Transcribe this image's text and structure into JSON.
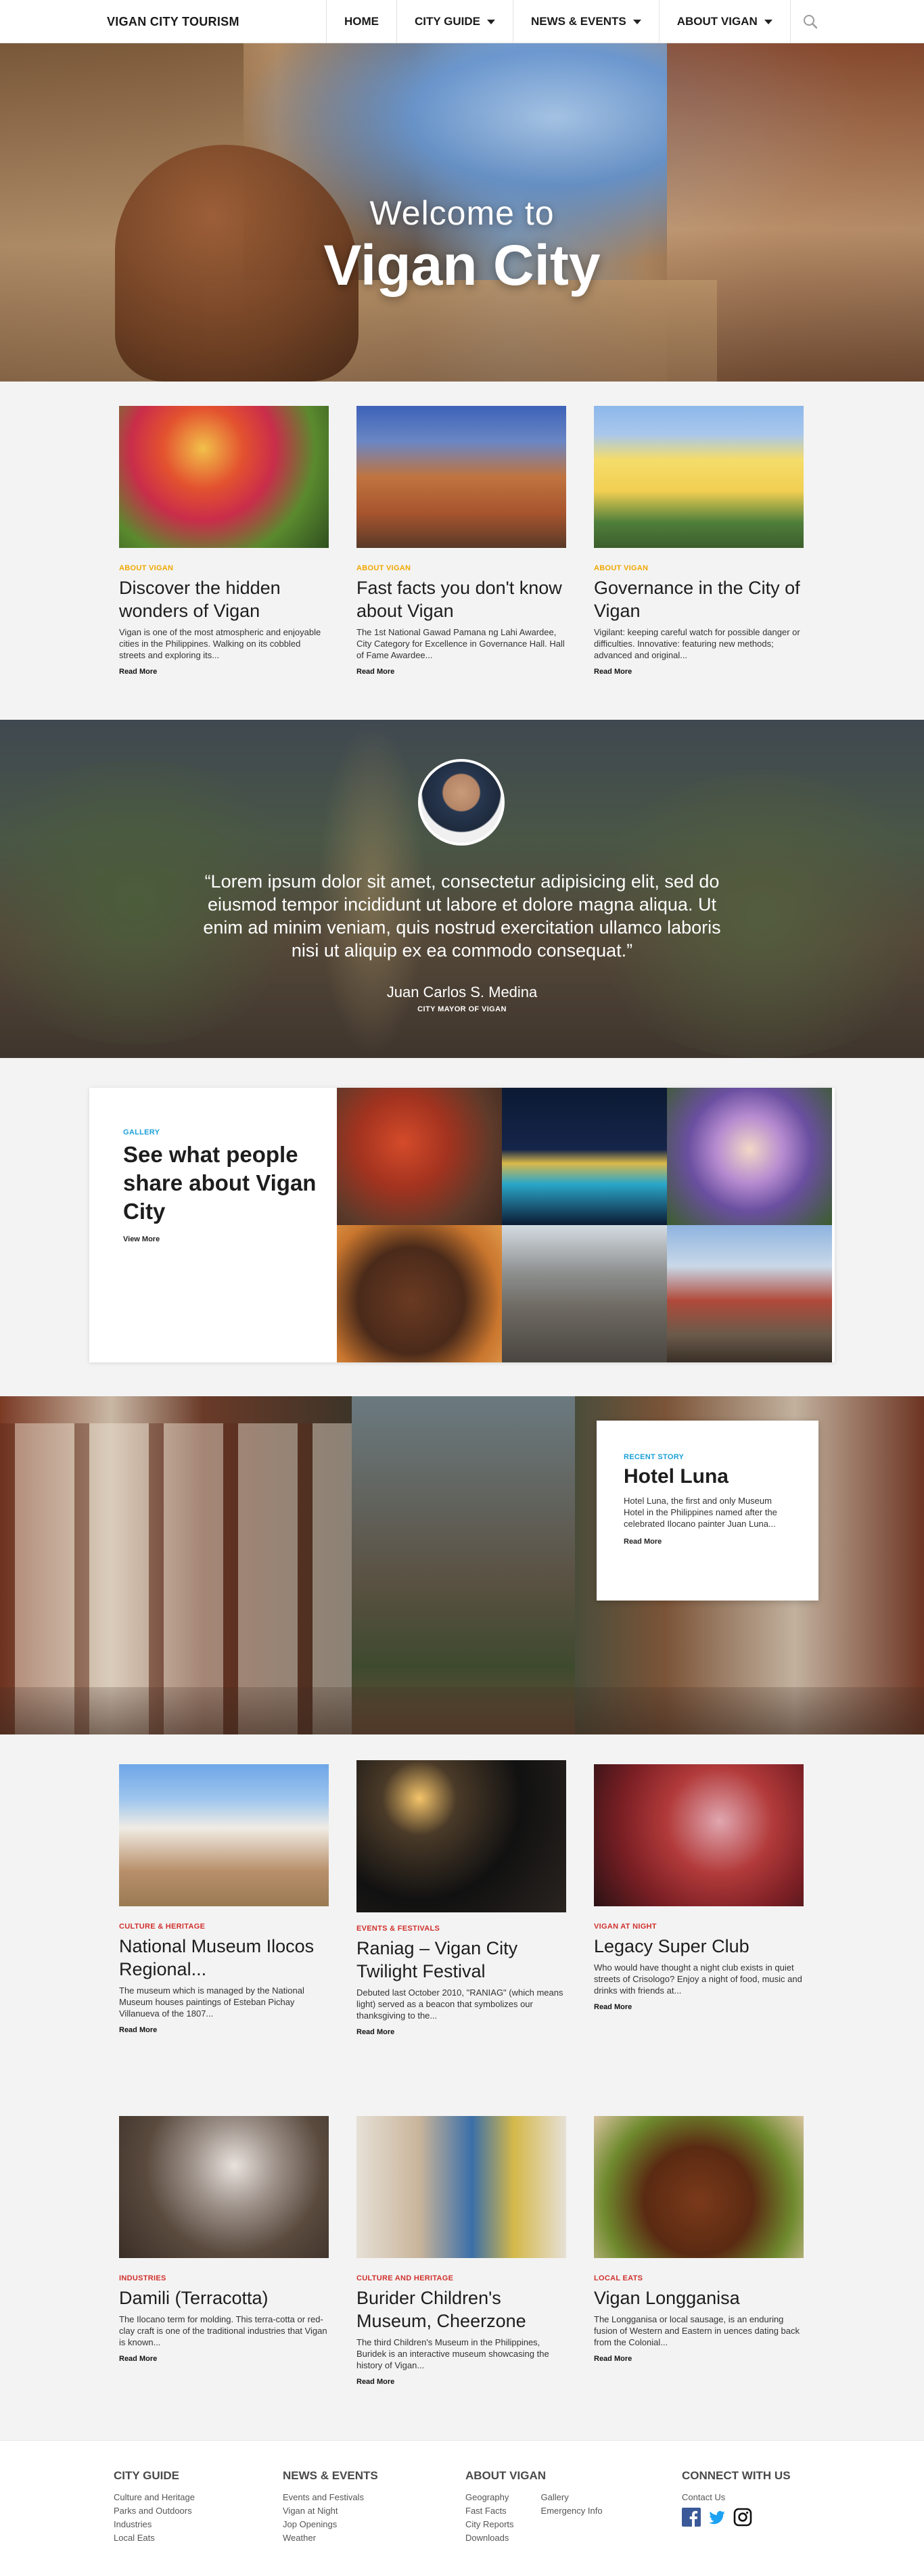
{
  "nav": {
    "brand": "VIGAN CITY TOURISM",
    "items": [
      {
        "label": "HOME"
      },
      {
        "label": "CITY GUIDE"
      },
      {
        "label": "NEWS & EVENTS"
      },
      {
        "label": "ABOUT VIGAN"
      }
    ],
    "search_icon": "search-icon"
  },
  "hero": {
    "welcome": "Welcome to",
    "title": "Vigan City"
  },
  "intro_cards": [
    {
      "category": "ABOUT VIGAN",
      "title": "Discover the hidden wonders of Vigan",
      "excerpt": "Vigan is one of the most atmospheric and enjoyable cities in the Philippines. Walking on its cobbled streets and exploring its...",
      "cta": "Read More"
    },
    {
      "category": "ABOUT VIGAN",
      "title": "Fast facts you don't know about Vigan",
      "excerpt": "The 1st National Gawad Pamana ng Lahi Awardee, City Category for Excellence in Governance Hall. Hall of Fame Awardee...",
      "cta": "Read More"
    },
    {
      "category": "ABOUT VIGAN",
      "title": "Governance in the City of Vigan",
      "excerpt": "Vigilant: keeping careful watch for possible danger or difficulties. Innovative:  featuring new methods; advanced and original...",
      "cta": "Read More"
    }
  ],
  "quote": {
    "text": "“Lorem ipsum dolor sit amet, consectetur adipisicing elit, sed do eiusmod tempor incididunt ut labore et dolore magna aliqua. Ut enim ad minim veniam, quis nostrud exercitation ullamco laboris nisi ut aliquip ex ea commodo consequat.”",
    "name": "Juan Carlos S. Medina",
    "role": "CITY MAYOR OF VIGAN"
  },
  "gallery": {
    "category": "GALLERY",
    "title": "See what people share about Vigan City",
    "cta": "View More"
  },
  "story": {
    "category": "RECENT STORY",
    "title": "Hotel Luna",
    "text": "Hotel Luna, the first and only Museum Hotel in the Philippines named after the celebrated Ilocano painter Juan Luna...",
    "cta": "Read More"
  },
  "list1": [
    {
      "category": "CULTURE & HERITAGE",
      "title": "National Museum Ilocos Regional...",
      "excerpt": "The museum which is managed by the National Museum houses paintings of Esteban Pichay Villanueva of the 1807...",
      "cta": "Read More"
    },
    {
      "category": "EVENTS & FESTIVALS",
      "title": "Raniag – Vigan City Twilight Festival",
      "excerpt": "Debuted last October 2010, \"RANIAG\" (which means light) served as a beacon that symbolizes our thanksgiving to the...",
      "cta": "Read More"
    },
    {
      "category": "VIGAN AT NIGHT",
      "title": "Legacy Super Club",
      "excerpt": "Who would have thought a night club exists in quiet streets of Crisologo? Enjoy a night of food, music and drinks with friends at...",
      "cta": "Read More"
    }
  ],
  "list2": [
    {
      "category": "INDUSTRIES",
      "title": "Damili (Terracotta)",
      "excerpt": "The Ilocano term for molding. This terra-cotta or red- clay craft is one of the traditional industries that Vigan is known...",
      "cta": "Read More"
    },
    {
      "category": "CULTURE AND HERITAGE",
      "title": "Burider Children's Museum, Cheerzone",
      "excerpt": "The third Children's Museum in the Philippines, Buridek is an interactive museum showcasing the history of Vigan...",
      "cta": "Read More"
    },
    {
      "category": "LOCAL EATS",
      "title": "Vigan Longganisa",
      "excerpt": "The Longganisa or local sausage, is an enduring fusion of Western and Eastern in uences dating back from the Colonial...",
      "cta": "Read More"
    }
  ],
  "footer": {
    "city_guide": {
      "heading": "CITY GUIDE",
      "links": [
        "Culture and Heritage",
        "Parks and Outdoors",
        "Industries",
        "Local Eats"
      ]
    },
    "news_events": {
      "heading": "NEWS & EVENTS",
      "links": [
        "Events and Festivals",
        "Vigan at Night",
        "Jop Openings",
        "Weather"
      ]
    },
    "about_vigan": {
      "heading": "ABOUT VIGAN",
      "links": [
        "Geography",
        "Fast Facts",
        "City Reports",
        "Downloads",
        "Gallery",
        "Emergency Info"
      ]
    },
    "connect": {
      "heading": "CONNECT WITH US",
      "link": "Contact Us",
      "social": [
        "facebook-icon",
        "twitter-icon",
        "instagram-icon"
      ]
    }
  },
  "colors": {
    "accent_yellow": "#f0a800",
    "accent_red": "#d0312d",
    "accent_blue": "#1aa0d8",
    "facebook": "#3b5998",
    "twitter": "#1da1f2"
  }
}
